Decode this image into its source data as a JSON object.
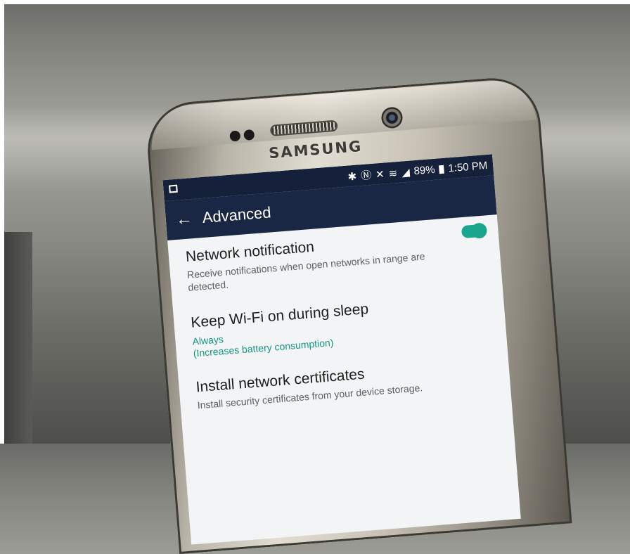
{
  "device": {
    "brand": "SAMSUNG"
  },
  "statusbar": {
    "icons": [
      "bluetooth-icon",
      "nfc-icon",
      "mute-icon",
      "wifi-icon",
      "signal-icon"
    ],
    "battery": "89%",
    "time": "1:50 PM"
  },
  "appbar": {
    "title": "Advanced",
    "back_icon": "arrow-left-icon"
  },
  "settings": [
    {
      "title": "Network notification",
      "subtitle": "Receive notifications when open networks in range are detected.",
      "toggle_on": true
    },
    {
      "title": "Keep Wi-Fi on during sleep",
      "value": "Always",
      "note": "(Increases battery consumption)"
    },
    {
      "title": "Install network certificates",
      "subtitle": "Install security certificates from your device storage."
    }
  ],
  "colors": {
    "accent": "#1aa58e",
    "appbar": "#1a2744",
    "statusbar": "#15203a"
  }
}
